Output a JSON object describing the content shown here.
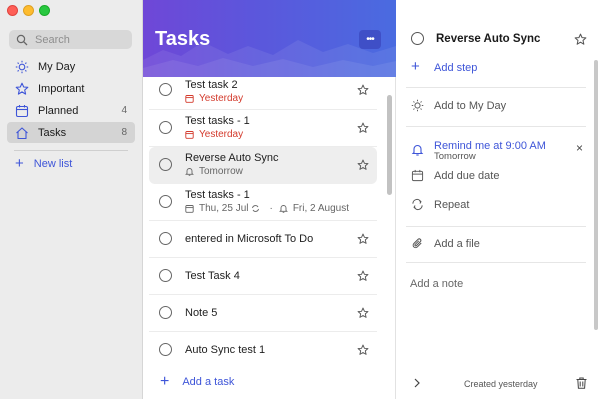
{
  "window": {
    "controls": [
      "close",
      "minimize",
      "zoom"
    ]
  },
  "sidebar": {
    "search": {
      "placeholder": "Search",
      "value": ""
    },
    "items": [
      {
        "label": "My Day",
        "icon": "sun-icon",
        "count": ""
      },
      {
        "label": "Important",
        "icon": "star-icon",
        "count": ""
      },
      {
        "label": "Planned",
        "icon": "calendar-icon",
        "count": "4"
      },
      {
        "label": "Tasks",
        "icon": "home-icon",
        "count": "8",
        "active": true
      }
    ],
    "new_list_label": "New list"
  },
  "list": {
    "title": "Tasks",
    "more_label": "•••",
    "tasks": [
      {
        "title": "Test task 2",
        "sub": "Yesterday",
        "sub_style": "overdue"
      },
      {
        "title": "Test tasks - 1",
        "sub": "Yesterday",
        "sub_style": "overdue"
      },
      {
        "title": "Reverse Auto Sync",
        "sub": "Tomorrow",
        "sub_style": "reminder",
        "selected": true
      },
      {
        "title": "Test tasks - 1",
        "sub": "Thu, 25 Jul",
        "sub2": "Fri, 2 August",
        "sub_style": "dates"
      },
      {
        "title": "entered in Microsoft To Do",
        "sub": ""
      },
      {
        "title": "Test Task 4",
        "sub": ""
      },
      {
        "title": "Note 5",
        "sub": ""
      },
      {
        "title": "Auto Sync test 1",
        "sub": ""
      }
    ],
    "add_task_label": "Add a task"
  },
  "detail": {
    "title": "Reverse Auto Sync",
    "add_step_label": "Add step",
    "add_my_day_label": "Add to My Day",
    "remind_label": "Remind me at 9:00 AM",
    "remind_sub": "Tomorrow",
    "remove_reminder": "×",
    "due_date_label": "Add due date",
    "repeat_label": "Repeat",
    "add_file_label": "Add a file",
    "note_placeholder": "Add a note",
    "created_label": "Created yesterday"
  },
  "colors": {
    "accent": "#3e55d8",
    "overdue": "#d33a2c",
    "banner_start": "#6f47d7",
    "banner_end": "#4a6be0"
  }
}
